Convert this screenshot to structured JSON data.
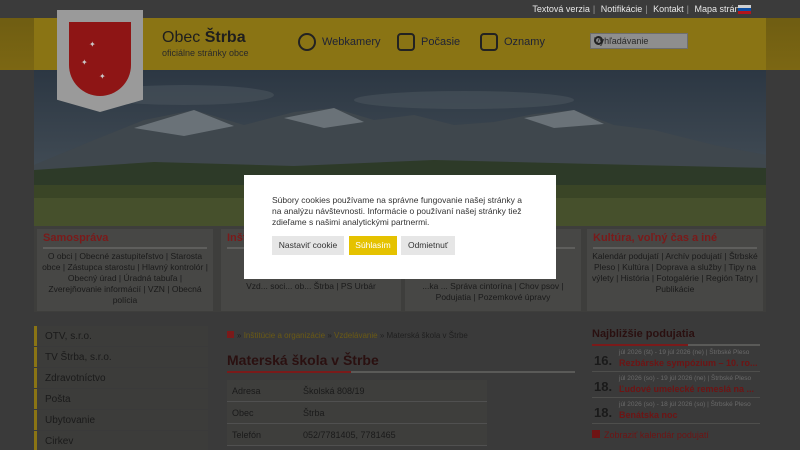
{
  "topbar": {
    "links": [
      "Textová verzia",
      "Notifikácie",
      "Kontakt",
      "Mapa stránok"
    ],
    "flag_colors": [
      "#ffffff",
      "#0b4ea2",
      "#ee1c25"
    ]
  },
  "header": {
    "title_prefix": "Obec",
    "title_name": "Štrba",
    "subtitle": "oficiálne stránky obce",
    "nav": [
      {
        "label": "Webkamery",
        "icon": "webcam-icon"
      },
      {
        "label": "Počasie",
        "icon": "weather-icon"
      },
      {
        "label": "Oznamy",
        "icon": "announcements-icon"
      }
    ],
    "search_placeholder": "Vyhľadávanie"
  },
  "categories": [
    {
      "title": "Samospráva",
      "text": "O obci | Obecné zastupiteľstvo | Starosta obce | Zástupca starostu | Hlavný kontrolór | Obecný úrad | Úradná tabuľa | Zverejňovanie informácií | VZN | Obecná polícia"
    },
    {
      "title": "Inšt",
      "text": "Vzd... soci... ob... Štrba | PS Urbár"
    },
    {
      "title": "",
      "text": "...ka ... Správa cintorína | Chov psov | Podujatia | Pozemkové úpravy"
    },
    {
      "title": "Kultúra, voľný čas a iné",
      "text": "Kalendár podujatí | Archív podujatí | Štrbské Pleso | Kultúra | Doprava a služby | Tipy na výlety | História | Fotogalérie | Región Tatry | Publikácie"
    }
  ],
  "sidebar": {
    "items": [
      "OTV, s.r.o.",
      "TV Štrba, s.r.o.",
      "Zdravotníctvo",
      "Pošta",
      "Ubytovanie",
      "Cirkev"
    ]
  },
  "breadcrumb": {
    "items": [
      "Inštitúcie a organizácie",
      "Vzdelávanie",
      "Materská škola v Štrbe"
    ],
    "separator": "»"
  },
  "main": {
    "title": "Materská škola v Štrbe",
    "rows": [
      {
        "label": "Adresa",
        "value": "Školská 808/19"
      },
      {
        "label": "Obec",
        "value": "Štrba"
      },
      {
        "label": "Telefón",
        "value": "052/7781405, 7781465"
      }
    ]
  },
  "events": {
    "title": "Najbližšie podujatia",
    "items": [
      {
        "day": "16.",
        "meta": "júl 2026 (št) - 19 júl 2026 (ne) | Štrbské Pleso",
        "title": "Rezbárske sympózium – 10. ro..."
      },
      {
        "day": "18.",
        "meta": "júl 2026 (so) - 19 júl 2026 (ne) | Štrbské Pleso",
        "title": "Ľudové umelecké remeslá na ..."
      },
      {
        "day": "18.",
        "meta": "júl 2026 (so) - 18 júl 2026 (so) | Štrbské Pleso",
        "title": "Benátska noc"
      }
    ],
    "calendar_link": "Zobraziť kalendár podujatí"
  },
  "cookie": {
    "message": "Súbory cookies používame na správne fungovanie našej stránky a na analýzu návštevnosti. Informácie o používaní našej stránky tiež zdieľame s našimi analytickými partnermi.",
    "settings_label": "Nastaviť cookie",
    "accept_label": "Súhlasím",
    "reject_label": "Odmietnuť"
  }
}
